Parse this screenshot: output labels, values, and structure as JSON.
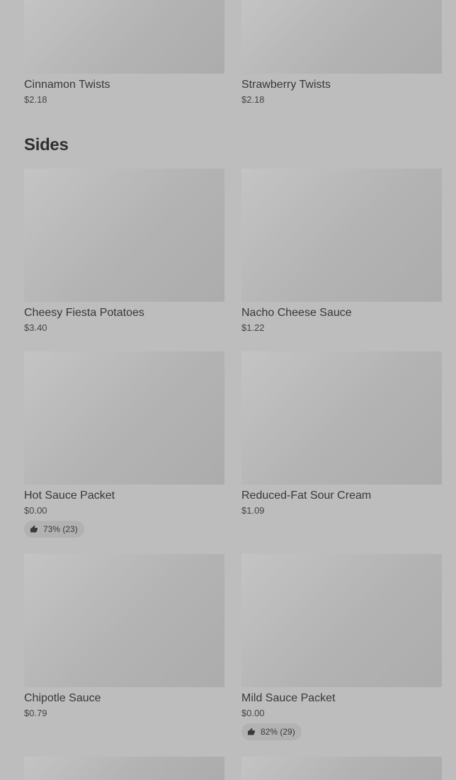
{
  "top_items": [
    {
      "name": "Cinnamon Twists",
      "price": "$2.18"
    },
    {
      "name": "Strawberry Twists",
      "price": "$2.18"
    }
  ],
  "sides": {
    "heading": "Sides",
    "items": [
      {
        "name": "Cheesy Fiesta Potatoes",
        "price": "$3.40"
      },
      {
        "name": "Nacho Cheese Sauce",
        "price": "$1.22"
      },
      {
        "name": "Hot Sauce Packet",
        "price": "$0.00",
        "rating": "73% (23)"
      },
      {
        "name": "Reduced-Fat Sour Cream",
        "price": "$1.09"
      },
      {
        "name": "Chipotle Sauce",
        "price": "$0.79"
      },
      {
        "name": "Mild Sauce Packet",
        "price": "$0.00",
        "rating": "82% (29)"
      }
    ]
  },
  "icons": {
    "rating_icon": "thumbs-up-icon"
  }
}
